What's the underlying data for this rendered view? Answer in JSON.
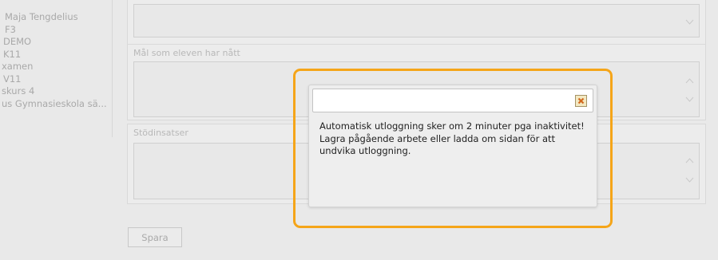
{
  "student_info": {
    "lines": [
      "Maja Tengdelius",
      "F3",
      "DEMO",
      "K11",
      "xamen",
      "V11",
      "skurs 4",
      "us Gymnasieskola sä..."
    ]
  },
  "sections": {
    "mal_label": "Mål som eleven har nått",
    "stod_label": "Stödinsatser"
  },
  "save_button": {
    "label": "Spara"
  },
  "dialog": {
    "title": "",
    "message_lines": [
      "Automatisk utloggning sker om 2 minuter pga inaktivitet!",
      "Lagra pågående arbete eller ladda om sidan för att",
      "undvika utloggning."
    ],
    "close_icon": "close-icon"
  },
  "colors": {
    "highlight": "#f5a519",
    "close_bg": "#f3e9c2",
    "close_x": "#d2691e"
  }
}
